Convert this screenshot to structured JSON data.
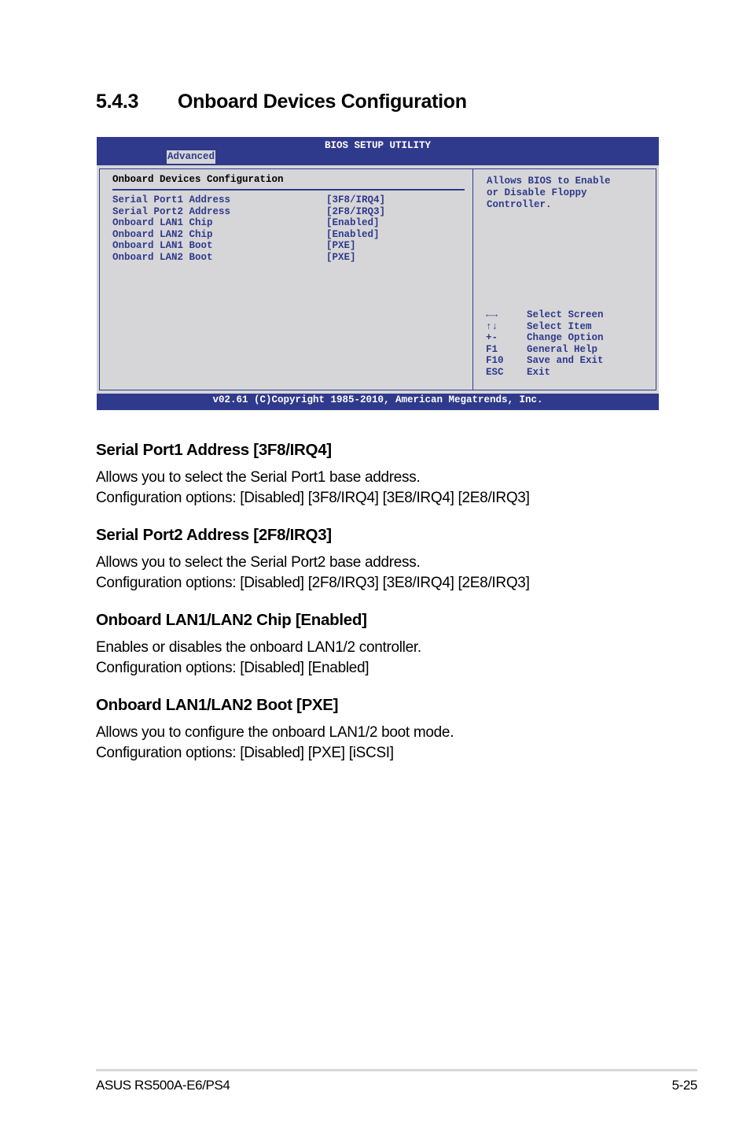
{
  "section": {
    "number": "5.4.3",
    "title": "Onboard Devices Configuration"
  },
  "bios": {
    "title": "BIOS SETUP UTILITY",
    "active_tab": "Advanced",
    "subtitle": "Onboard Devices Configuration",
    "items": [
      {
        "label": "Serial Port1 Address",
        "value": "[3F8/IRQ4]"
      },
      {
        "label": "Serial Port2 Address",
        "value": "[2F8/IRQ3]"
      },
      {
        "label": "Onboard LAN1 Chip",
        "value": "[Enabled]"
      },
      {
        "label": "Onboard LAN2 Chip",
        "value": "[Enabled]"
      },
      {
        "label": "Onboard LAN1 Boot",
        "value": "[PXE]"
      },
      {
        "label": "Onboard LAN2 Boot",
        "value": "[PXE]"
      }
    ],
    "help_text": "Allows BIOS to Enable\nor Disable Floppy\nController.",
    "keys": [
      {
        "key": "←→",
        "action": "Select Screen"
      },
      {
        "key": "↑↓",
        "action": "Select Item"
      },
      {
        "key": "+-",
        "action": "Change Option"
      },
      {
        "key": "F1",
        "action": "General Help"
      },
      {
        "key": "F10",
        "action": "Save and Exit"
      },
      {
        "key": "ESC",
        "action": "Exit"
      }
    ],
    "footer": "v02.61 (C)Copyright 1985-2010, American Megatrends, Inc.",
    "colors": {
      "header": "#303a8c",
      "panel": "#d6d6d8",
      "text": "#303a8c"
    }
  },
  "descriptions": [
    {
      "heading": "Serial Port1 Address [3F8/IRQ4]",
      "line1": "Allows you to select the Serial Port1 base address.",
      "line2": "Configuration options: [Disabled] [3F8/IRQ4] [3E8/IRQ4] [2E8/IRQ3]"
    },
    {
      "heading": "Serial Port2 Address [2F8/IRQ3]",
      "line1": "Allows you to select the Serial Port2 base address.",
      "line2": "Configuration options: [Disabled] [2F8/IRQ3] [3E8/IRQ4] [2E8/IRQ3]"
    },
    {
      "heading": "Onboard LAN1/LAN2 Chip [Enabled]",
      "line1": "Enables or disables the onboard LAN1/2 controller.",
      "line2": "Configuration options: [Disabled] [Enabled]"
    },
    {
      "heading": "Onboard LAN1/LAN2 Boot [PXE]",
      "line1": "Allows you to configure the onboard LAN1/2 boot mode.",
      "line2": "Configuration options: [Disabled] [PXE] [iSCSI]"
    }
  ],
  "footer": {
    "product": "ASUS RS500A-E6/PS4",
    "page": "5-25"
  }
}
